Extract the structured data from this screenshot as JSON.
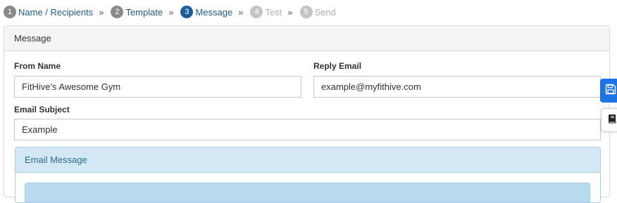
{
  "stepper": {
    "steps": [
      {
        "num": "1",
        "label": "Name / Recipients",
        "state": "done"
      },
      {
        "num": "2",
        "label": "Template",
        "state": "done"
      },
      {
        "num": "3",
        "label": "Message",
        "state": "active"
      },
      {
        "num": "4",
        "label": "Test",
        "state": "pending"
      },
      {
        "num": "5",
        "label": "Send",
        "state": "pending"
      }
    ],
    "separator": "»"
  },
  "panel": {
    "title": "Message",
    "from_name": {
      "label": "From Name",
      "value": "FitHive's Awesome Gym"
    },
    "reply_email": {
      "label": "Reply Email",
      "value": "example@myfithive.com"
    },
    "subject": {
      "label": "Email Subject",
      "value": "Example"
    },
    "message": {
      "title": "Email Message"
    }
  },
  "tools": {
    "save_icon": "floppy-disk-icon",
    "book_icon": "book-icon"
  },
  "colors": {
    "active_step": "#1a5e9b",
    "done_step": "#8a8a8a",
    "pending_step": "#c4c4c4",
    "save_button": "#1c73e3",
    "message_header": "#d3e8f4"
  }
}
